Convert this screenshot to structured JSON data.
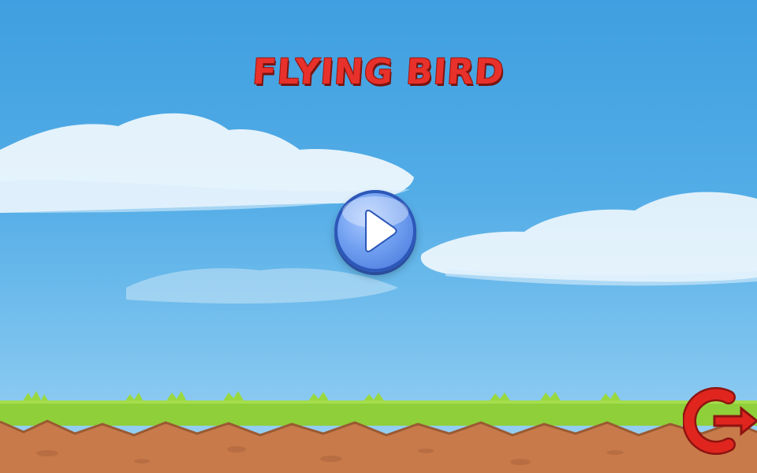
{
  "game": {
    "title": "FLYING BIRD"
  },
  "buttons": {
    "play_icon": "play-icon",
    "exit_icon": "exit-icon"
  },
  "colors": {
    "sky": "#52ace6",
    "title": "#e8312b",
    "grass": "#8fcf3a",
    "dirt": "#c97a4a",
    "play_button": "#6f9ef0",
    "exit_button": "#e0251f"
  }
}
